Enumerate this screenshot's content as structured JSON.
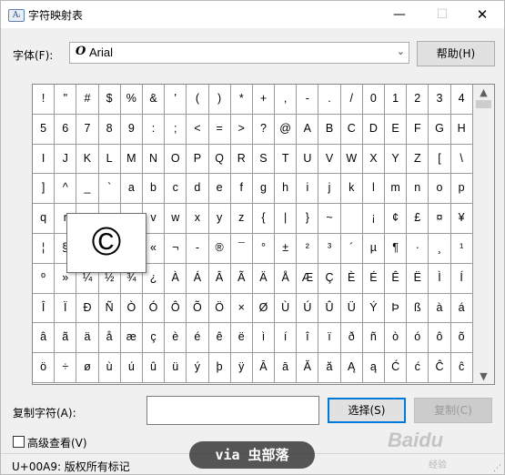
{
  "window": {
    "icon_text": "Aᵢ",
    "title": "字符映射表",
    "minimize": "—",
    "maximize": "☐",
    "close": "✕"
  },
  "font": {
    "label": "字体(F):",
    "value": "Arial",
    "type_icon": "O"
  },
  "help_button": "帮助(H)",
  "grid": {
    "rows": [
      [
        "!",
        "\"",
        "#",
        "$",
        "%",
        "&",
        "'",
        "(",
        ")",
        "*",
        "+",
        ",",
        "-",
        ".",
        "/",
        "0",
        "1",
        "2",
        "3",
        "4"
      ],
      [
        "5",
        "6",
        "7",
        "8",
        "9",
        ":",
        ";",
        "<",
        "=",
        ">",
        "?",
        "@",
        "A",
        "B",
        "C",
        "D",
        "E",
        "F",
        "G",
        "H"
      ],
      [
        "I",
        "J",
        "K",
        "L",
        "M",
        "N",
        "O",
        "P",
        "Q",
        "R",
        "S",
        "T",
        "U",
        "V",
        "W",
        "X",
        "Y",
        "Z",
        "[",
        "\\"
      ],
      [
        "]",
        "^",
        "_",
        "`",
        "a",
        "b",
        "c",
        "d",
        "e",
        "f",
        "g",
        "h",
        "i",
        "j",
        "k",
        "l",
        "m",
        "n",
        "o",
        "p"
      ],
      [
        "q",
        "r",
        "s",
        "t",
        "u",
        "v",
        "w",
        "x",
        "y",
        "z",
        "{",
        "|",
        "}",
        "~",
        " ",
        "¡",
        "¢",
        "£",
        "¤",
        "¥"
      ],
      [
        "¦",
        "§",
        "¨",
        "©",
        "ª",
        "«",
        "¬",
        "-",
        "®",
        "¯",
        "°",
        "±",
        "²",
        "³",
        "´",
        "µ",
        "¶",
        "·",
        "¸",
        "¹"
      ],
      [
        "º",
        "»",
        "¼",
        "½",
        "¾",
        "¿",
        "À",
        "Á",
        "Â",
        "Ã",
        "Ä",
        "Å",
        "Æ",
        "Ç",
        "È",
        "É",
        "Ê",
        "Ë",
        "Ì",
        "Í"
      ],
      [
        "Î",
        "Ï",
        "Ð",
        "Ñ",
        "Ò",
        "Ó",
        "Ô",
        "Õ",
        "Ö",
        "×",
        "Ø",
        "Ù",
        "Ú",
        "Û",
        "Ü",
        "Ý",
        "Þ",
        "ß",
        "à",
        "á"
      ],
      [
        "â",
        "ã",
        "ä",
        "å",
        "æ",
        "ç",
        "è",
        "é",
        "ê",
        "ë",
        "ì",
        "í",
        "î",
        "ï",
        "ð",
        "ñ",
        "ò",
        "ó",
        "ô",
        "õ"
      ],
      [
        "ö",
        "÷",
        "ø",
        "ù",
        "ú",
        "û",
        "ü",
        "ý",
        "þ",
        "ÿ",
        "Ā",
        "ā",
        "Ă",
        "ă",
        "Ą",
        "ą",
        "Ć",
        "ć",
        "Ĉ",
        "ĉ"
      ]
    ],
    "scroll_up": "▲",
    "scroll_down": "▼"
  },
  "preview": {
    "char": "©"
  },
  "copy": {
    "label": "复制字符(A):",
    "value": "",
    "select_button": "选择(S)",
    "copy_button": "复制(C)"
  },
  "advanced": {
    "label": "高级查看(V)",
    "checked": false
  },
  "status": {
    "text": "U+00A9: 版权所有标记"
  },
  "watermark": {
    "text": "via 虫部落",
    "logo": "Baidu",
    "logo_sub": "经验"
  }
}
